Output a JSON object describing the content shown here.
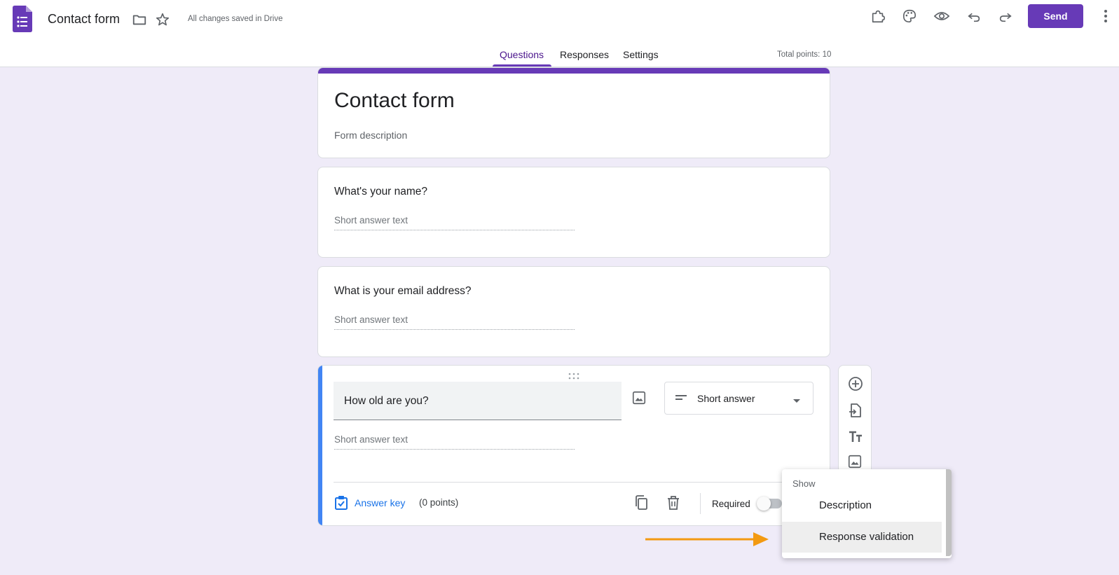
{
  "header": {
    "doc_title": "Contact form",
    "save_status": "All changes saved in Drive",
    "send_label": "Send"
  },
  "tabs": {
    "questions": "Questions",
    "responses": "Responses",
    "settings": "Settings",
    "active": "Questions",
    "total_points": "Total points: 10"
  },
  "form": {
    "title": "Contact form",
    "description_placeholder": "Form description"
  },
  "questions": [
    {
      "title": "What's your name?",
      "answer_placeholder": "Short answer text"
    },
    {
      "title": "What is your email address?",
      "answer_placeholder": "Short answer text"
    },
    {
      "title": "How old are you?",
      "answer_placeholder": "Short answer text",
      "type": "Short answer"
    }
  ],
  "active_question": {
    "answer_key_label": "Answer key",
    "points_label": "(0 points)",
    "required_label": "Required",
    "required": false
  },
  "menu": {
    "header": "Show",
    "items": [
      "Description",
      "Response validation"
    ],
    "highlighted": "Response validation"
  },
  "colors": {
    "accent": "#673ab7",
    "background": "#efebf8",
    "active_bar": "#4285f4",
    "link": "#1a73e8",
    "annotation_arrow": "#f39a12"
  },
  "icons": {
    "logo": "forms-logo-icon",
    "folder": "folder-icon",
    "star": "star-icon",
    "addons": "puzzle-icon",
    "theme": "palette-icon",
    "preview": "eye-icon",
    "undo": "undo-icon",
    "redo": "redo-icon",
    "more": "more-vert-icon"
  }
}
